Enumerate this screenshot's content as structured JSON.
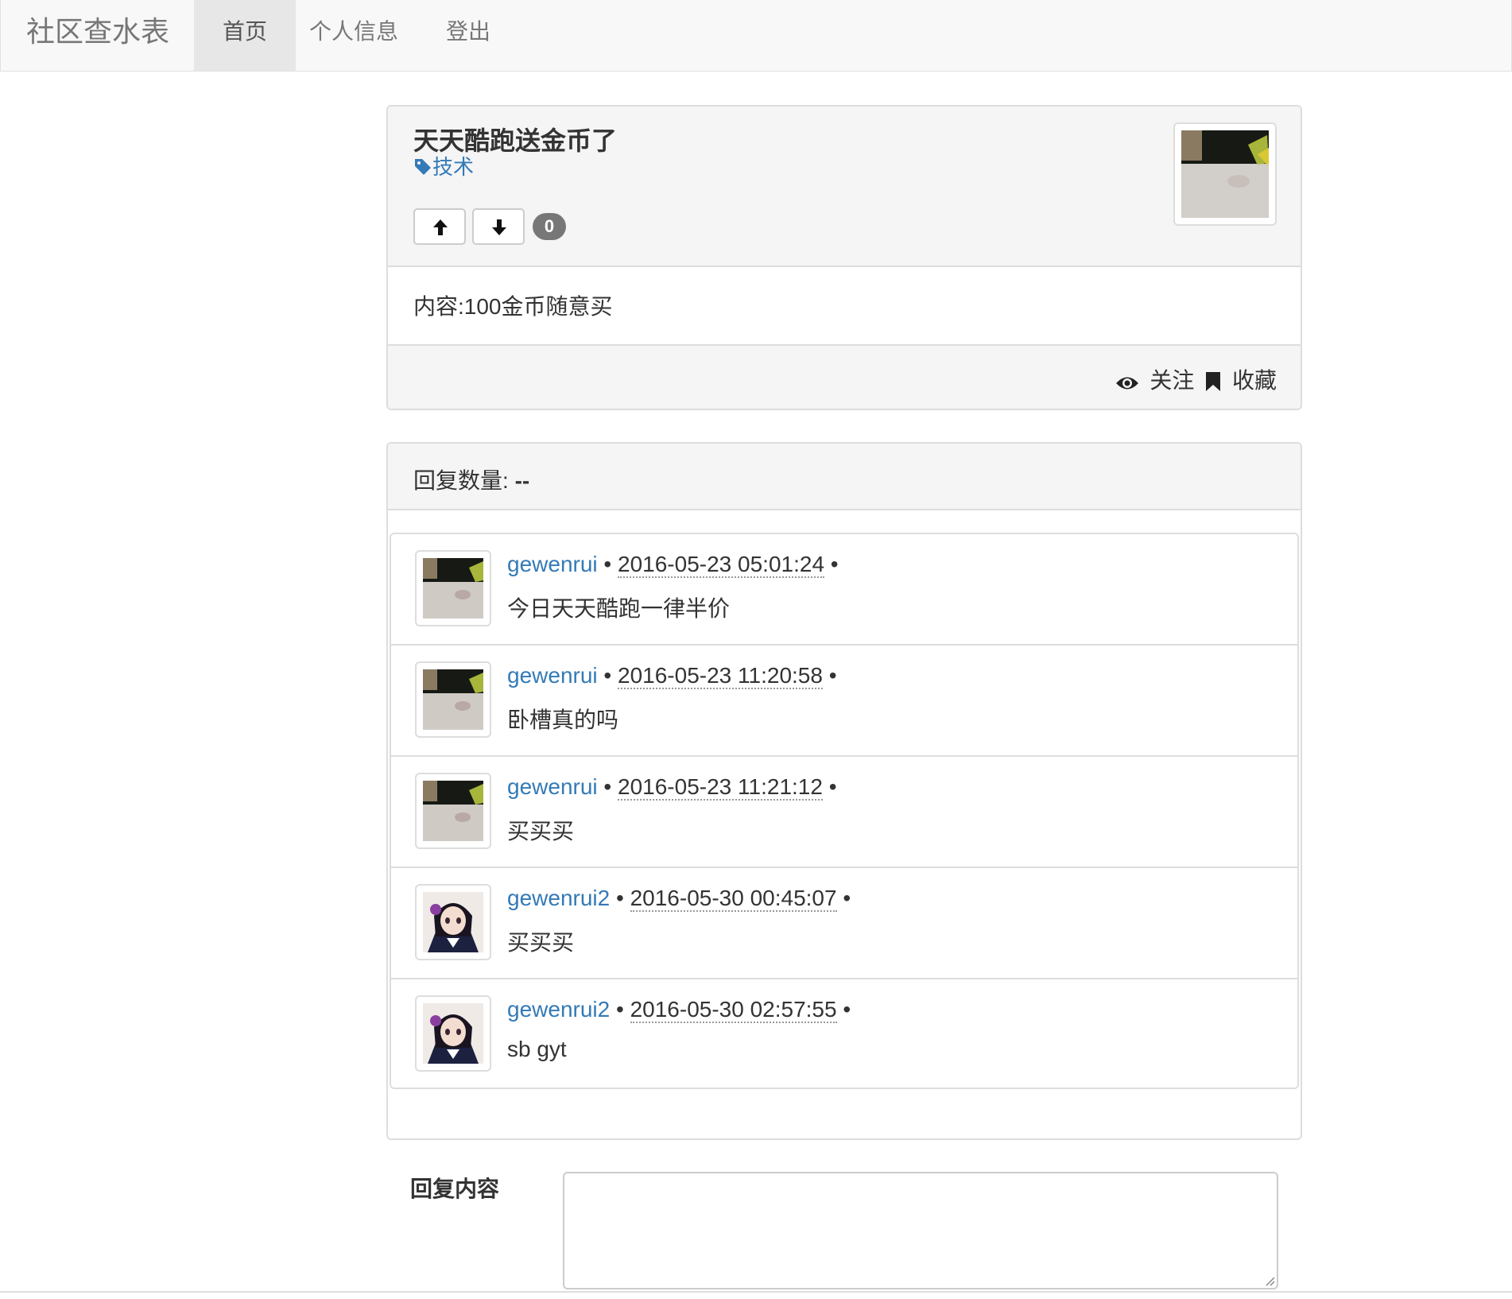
{
  "navbar": {
    "brand": "社区查水表",
    "items": [
      {
        "label": "首页",
        "active": true
      },
      {
        "label": "个人信息",
        "active": false
      },
      {
        "label": "登出",
        "active": false
      }
    ]
  },
  "post": {
    "title": "天天酷跑送金币了",
    "tag": "技术",
    "tag_icon": "tag-icon",
    "vote_count": "0",
    "content": "内容:100金币随意买",
    "actions": {
      "follow_label": "关注",
      "follow_icon": "eye-icon",
      "bookmark_label": "收藏",
      "bookmark_icon": "bookmark-icon"
    }
  },
  "replies": {
    "count_label": "回复数量:",
    "count_value": "--",
    "items": [
      {
        "user": "gewenrui",
        "time": "2016-05-23 05:01:24",
        "text": "今日天天酷跑一律半价"
      },
      {
        "user": "gewenrui",
        "time": "2016-05-23 11:20:58",
        "text": "卧槽真的吗"
      },
      {
        "user": "gewenrui",
        "time": "2016-05-23 11:21:12",
        "text": "买买买"
      },
      {
        "user": "gewenrui2",
        "time": "2016-05-30 00:45:07",
        "text": "买买买"
      },
      {
        "user": "gewenrui2",
        "time": "2016-05-30 02:57:55",
        "text": "sb gyt"
      }
    ]
  },
  "reply_form": {
    "label": "回复内容",
    "value": ""
  },
  "colors": {
    "link": "#337ab7",
    "panel_bg": "#f5f5f5",
    "border": "#dddddd",
    "badge": "#777777"
  }
}
